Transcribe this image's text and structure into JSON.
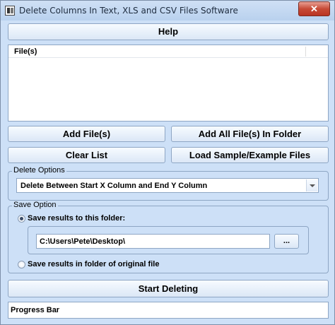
{
  "window": {
    "title": "Delete Columns In Text, XLS and CSV Files Software",
    "close_label": "✕"
  },
  "toolbar": {
    "help_label": "Help"
  },
  "file_list": {
    "column_header": "File(s)",
    "items": []
  },
  "buttons": {
    "add_files": "Add File(s)",
    "add_all_files": "Add All File(s) In Folder",
    "clear_list": "Clear List",
    "load_sample": "Load Sample/Example Files",
    "start_deleting": "Start Deleting",
    "browse": "..."
  },
  "delete_options": {
    "group_label": "Delete Options",
    "selected": "Delete Between Start X Column and End Y Column"
  },
  "save_option": {
    "group_label": "Save Option",
    "option_folder_label": "Save results to this folder:",
    "option_original_label": "Save results in folder of original file",
    "selected": "folder",
    "folder_path": "C:\\Users\\Pete\\Desktop\\"
  },
  "progress": {
    "label": "Progress Bar"
  }
}
